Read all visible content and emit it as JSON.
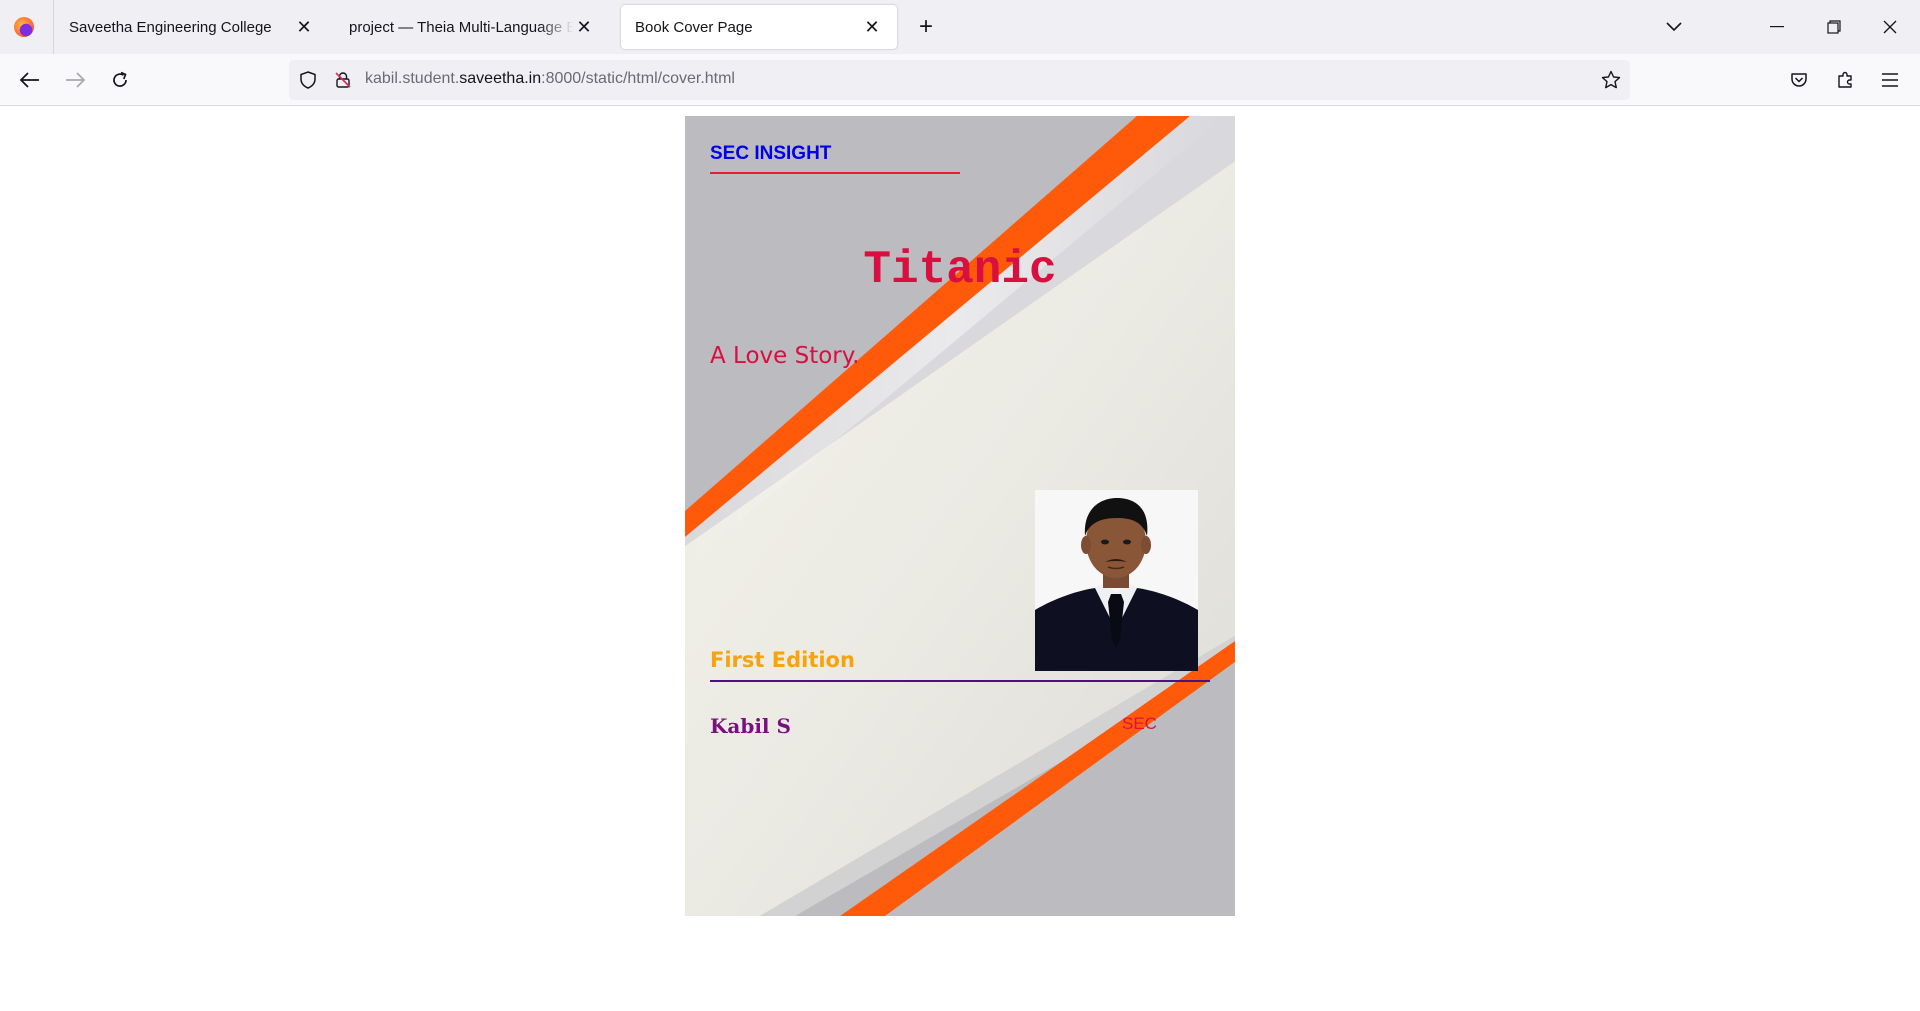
{
  "browser": {
    "tabs": [
      {
        "title": "Saveetha Engineering College",
        "active": false
      },
      {
        "title": "project — Theia Multi-Language Ex",
        "active": false
      },
      {
        "title": "Book Cover Page",
        "active": true
      }
    ],
    "url": {
      "prefix": "kabil.student.",
      "host": "saveetha.in",
      "suffix": ":8000/static/html/cover.html"
    },
    "icons": {
      "back": "arrow-left-icon",
      "forward": "arrow-right-icon",
      "reload": "reload-icon",
      "tracking": "shield-icon",
      "permissions": "not-secure-lock-icon",
      "bookmark": "star-icon",
      "pocket": "pocket-icon",
      "extensions": "puzzle-icon",
      "menu": "hamburger-menu-icon"
    }
  },
  "cover": {
    "series": "SEC INSIGHT",
    "title": "Titanic",
    "subtitle": "A Love Story.",
    "edition": "First Edition",
    "author": "Kabil S",
    "publisher": "SEC"
  },
  "colors": {
    "series": "#0000ee",
    "title": "#d8103f",
    "edition": "#f5a30f",
    "author": "#7a0f7d",
    "stripe": "#ff5a0a"
  }
}
